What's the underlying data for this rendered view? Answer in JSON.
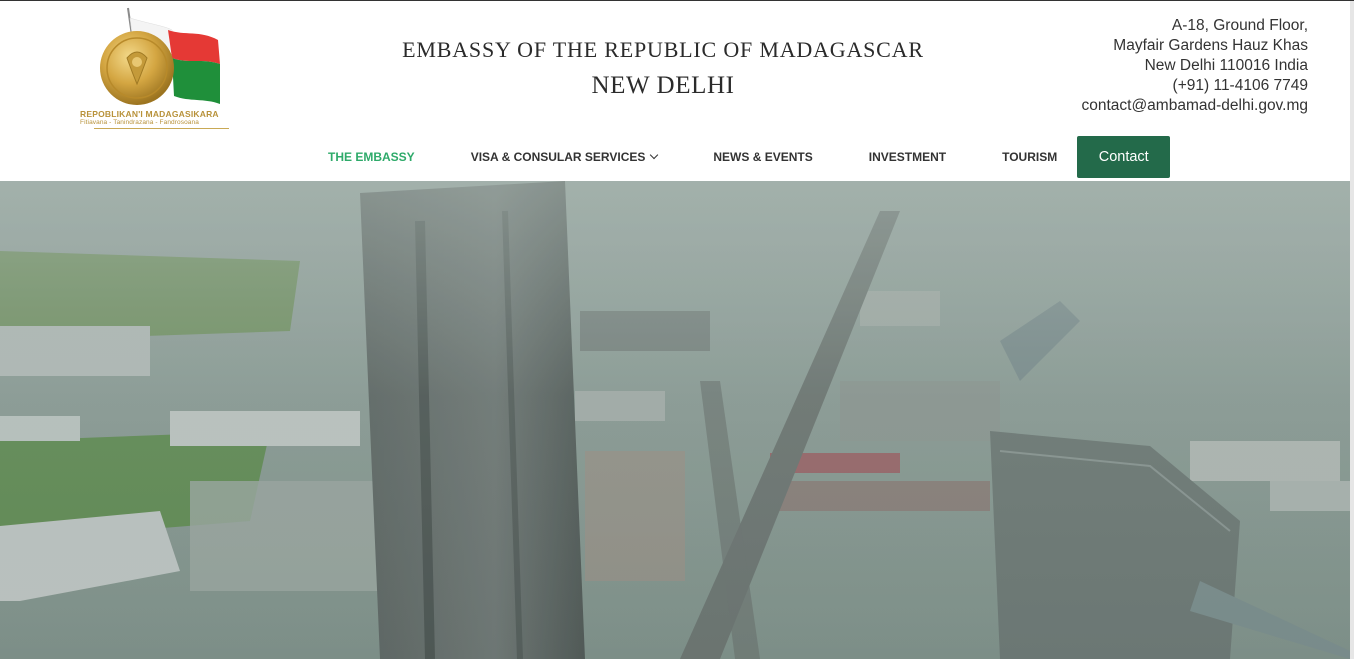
{
  "header": {
    "logo": {
      "icon": "madagascar-seal-flag-logo",
      "text": "REPOBLIKAN'I MADAGASIKARA",
      "motto": "Fitiavana - Tanindrazana - Fandrosoana"
    },
    "title": "EMBASSY OF THE REPUBLIC OF MADAGASCAR",
    "subtitle": "NEW DELHI",
    "address": {
      "line1": "A-18, Ground Floor,",
      "line2": "Mayfair Gardens Hauz Khas",
      "line3": "New Delhi 110016 India",
      "phone": "(+91) 11-4106 7749",
      "email": "contact@ambamad-delhi.gov.mg"
    }
  },
  "nav": {
    "items": [
      {
        "label": "THE EMBASSY",
        "active": true
      },
      {
        "label": "VISA & CONSULAR SERVICES",
        "dropdown": true
      },
      {
        "label": "NEWS & EVENTS"
      },
      {
        "label": "INVESTMENT"
      },
      {
        "label": "TOURISM"
      }
    ],
    "contact_label": "Contact"
  },
  "hero": {
    "image": "aerial-city-view-antananarivo"
  },
  "colors": {
    "accent_green": "#2eaa6a",
    "button_green": "#236a4a",
    "text_dark": "#333333",
    "logo_gold": "#b8923a"
  }
}
